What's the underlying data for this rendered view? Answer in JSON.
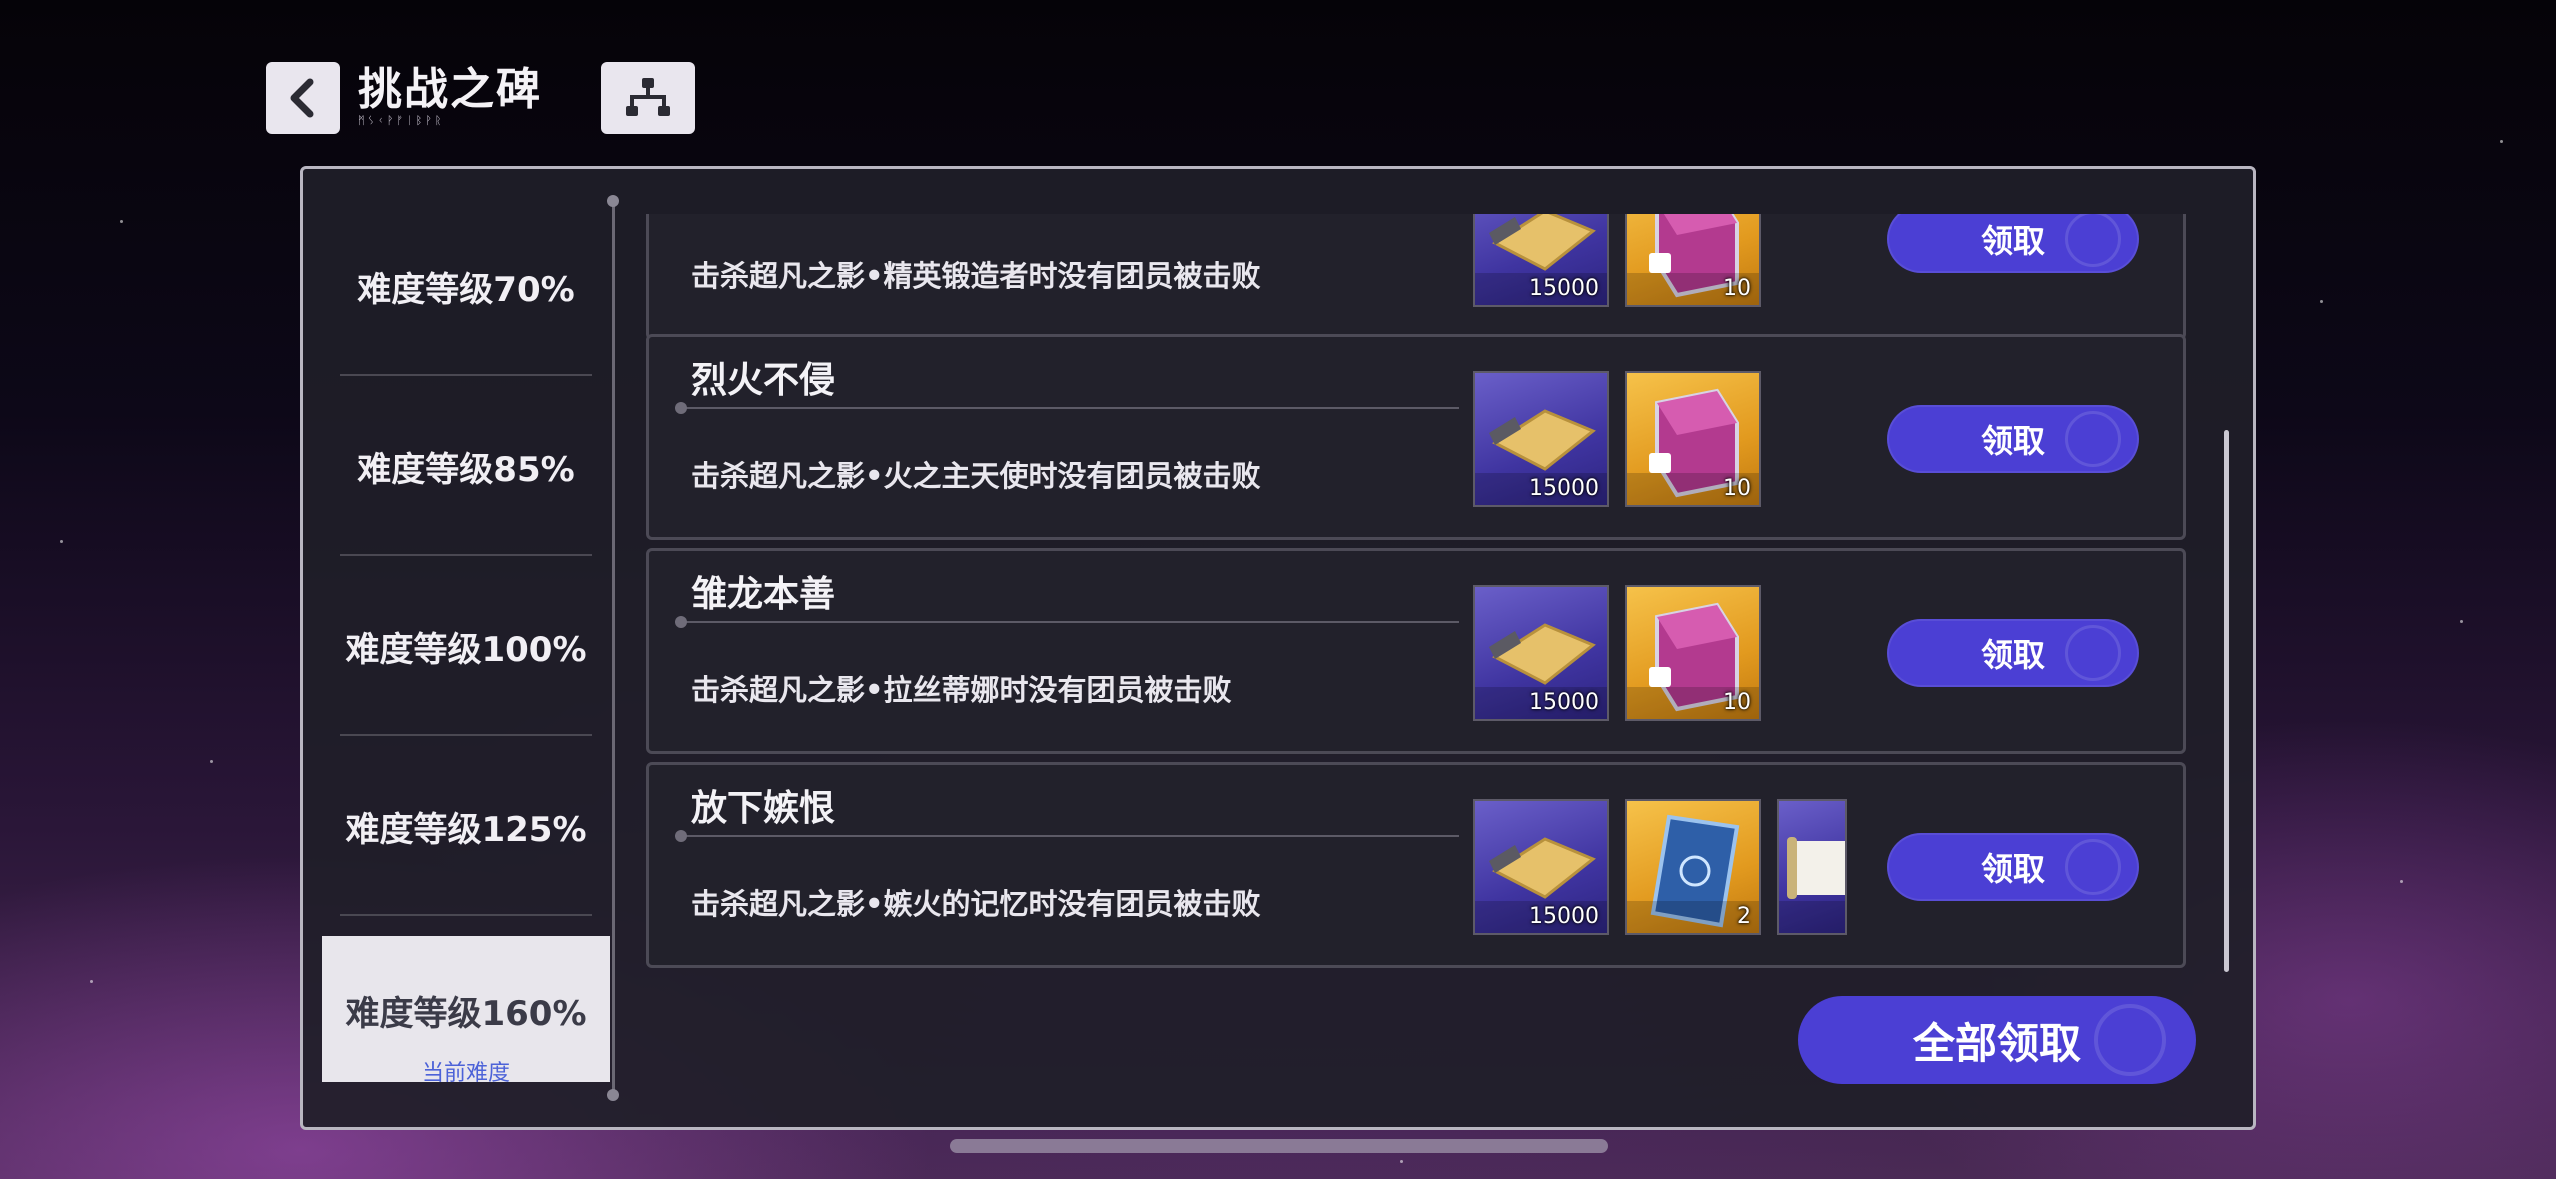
{
  "header": {
    "title": "挑战之碑",
    "subtitle": "ᛗᛊᚲᚹᚠᛁᛒᚹᚱ"
  },
  "sidebar": {
    "items": [
      {
        "label": "难度等级70%"
      },
      {
        "label": "难度等级85%"
      },
      {
        "label": "难度等级100%"
      },
      {
        "label": "难度等级125%"
      }
    ],
    "active": {
      "label": "难度等级160%",
      "current_tag": "当前难度"
    }
  },
  "cards": [
    {
      "title": "",
      "desc": "击杀超凡之影•精英锻造者时没有团员被击败",
      "rewards": [
        {
          "icon": "gold-ticket-icon",
          "qty": "15000",
          "bg": "purple"
        },
        {
          "icon": "locked-crystal-cube-icon",
          "qty": "10",
          "bg": "gold"
        }
      ],
      "button": "领取"
    },
    {
      "title": "烈火不侵",
      "desc": "击杀超凡之影•火之主天使时没有团员被击败",
      "rewards": [
        {
          "icon": "gold-ticket-icon",
          "qty": "15000",
          "bg": "purple"
        },
        {
          "icon": "locked-crystal-cube-icon",
          "qty": "10",
          "bg": "gold"
        }
      ],
      "button": "领取"
    },
    {
      "title": "雏龙本善",
      "desc": "击杀超凡之影•拉丝蒂娜时没有团员被击败",
      "rewards": [
        {
          "icon": "gold-ticket-icon",
          "qty": "15000",
          "bg": "purple"
        },
        {
          "icon": "locked-crystal-cube-icon",
          "qty": "10",
          "bg": "gold"
        }
      ],
      "button": "领取"
    },
    {
      "title": "放下嫉恨",
      "desc": "击杀超凡之影•嫉火的记忆时没有团员被击败",
      "rewards": [
        {
          "icon": "gold-ticket-icon",
          "qty": "15000",
          "bg": "purple"
        },
        {
          "icon": "blue-card-icon",
          "qty": "2",
          "bg": "gold"
        },
        {
          "icon": "scroll-icon",
          "qty": "",
          "bg": "purple"
        }
      ],
      "button": "领取"
    }
  ],
  "claim_all": "全部领取",
  "colors": {
    "accent": "#4b3fd4",
    "panel": "#22212b",
    "gold": "#e8a52a",
    "purple": "#4a3fb0"
  }
}
